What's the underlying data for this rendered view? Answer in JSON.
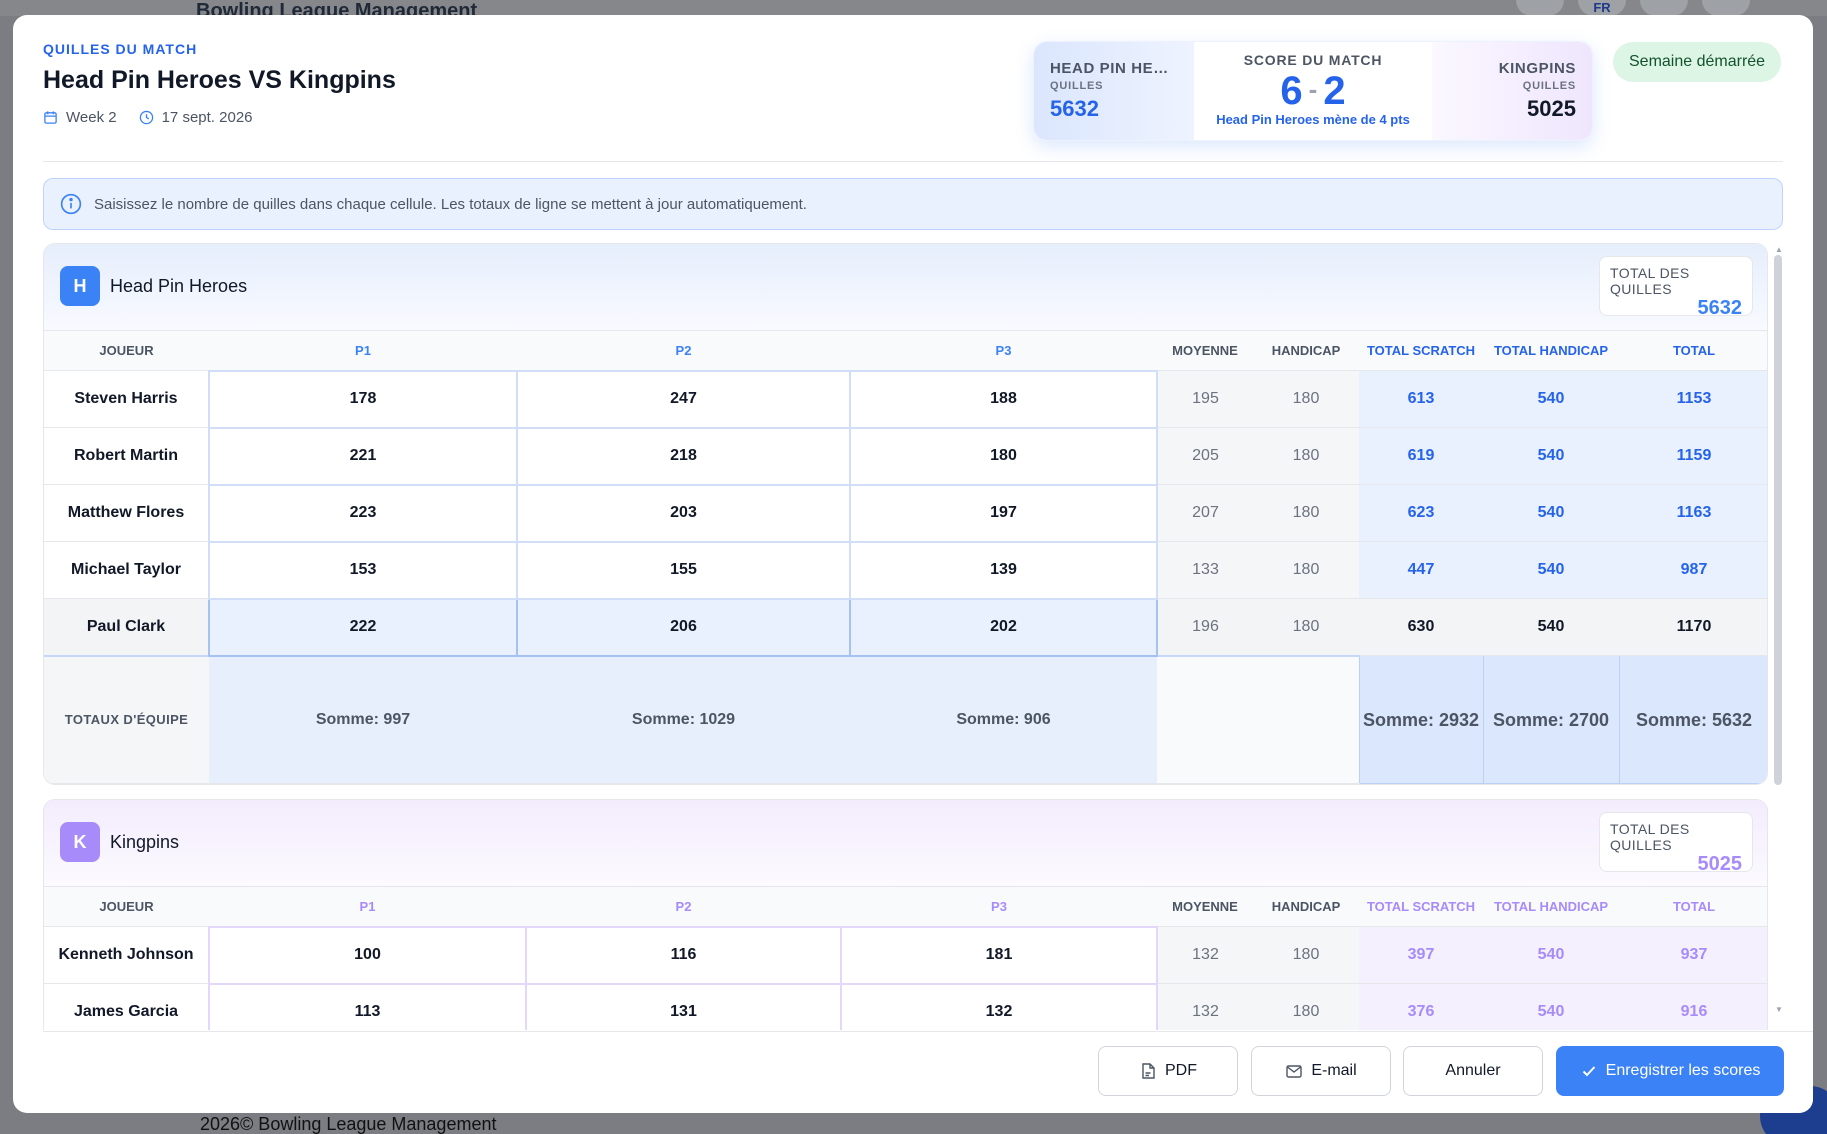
{
  "background": {
    "app_title": "Bowling League Management",
    "lang": "FR",
    "footer": "2026©  Bowling League Management"
  },
  "modal": {
    "eyebrow": "QUILLES DU MATCH",
    "title": "Head Pin Heroes VS Kingpins",
    "week": "Week 2",
    "date": "17 sept. 2026",
    "status": "Semaine démarrée",
    "info": "Saisissez le nombre de quilles dans chaque cellule. Les totaux de ligne se mettent à jour automatiquement."
  },
  "scorecard": {
    "left_name": "HEAD PIN HER...",
    "left_label": "QUILLES",
    "left_value": "5632",
    "mid_label": "SCORE DU MATCH",
    "home_points": "6",
    "away_points": "2",
    "lead_text": "Head Pin Heroes mène de 4 pts",
    "right_name": "KINGPINS",
    "right_label": "QUILLES",
    "right_value": "5025"
  },
  "columns": {
    "player": "JOUEUR",
    "p1": "P1",
    "p2": "P2",
    "p3": "P3",
    "avg": "MOYENNE",
    "hcp": "HANDICAP",
    "tscratch": "TOTAL SCRATCH",
    "thcp": "TOTAL HANDICAP",
    "total": "TOTAL"
  },
  "teamA": {
    "badge": "H",
    "name": "Head Pin Heroes",
    "total_label": "TOTAL DES QUILLES",
    "total_value": "5632",
    "rows": [
      {
        "player": "Steven Harris",
        "p1": "178",
        "p2": "247",
        "p3": "188",
        "avg": "195",
        "hcp": "180",
        "tscratch": "613",
        "thcp": "540",
        "total": "1153"
      },
      {
        "player": "Robert Martin",
        "p1": "221",
        "p2": "218",
        "p3": "180",
        "avg": "205",
        "hcp": "180",
        "tscratch": "619",
        "thcp": "540",
        "total": "1159"
      },
      {
        "player": "Matthew Flores",
        "p1": "223",
        "p2": "203",
        "p3": "197",
        "avg": "207",
        "hcp": "180",
        "tscratch": "623",
        "thcp": "540",
        "total": "1163"
      },
      {
        "player": "Michael Taylor",
        "p1": "153",
        "p2": "155",
        "p3": "139",
        "avg": "133",
        "hcp": "180",
        "tscratch": "447",
        "thcp": "540",
        "total": "987"
      },
      {
        "player": "Paul Clark",
        "p1": "222",
        "p2": "206",
        "p3": "202",
        "avg": "196",
        "hcp": "180",
        "tscratch": "630",
        "thcp": "540",
        "total": "1170"
      }
    ],
    "totals_label": "TOTAUX D'ÉQUIPE",
    "sum_p1": "Somme: 997",
    "sum_p2": "Somme: 1029",
    "sum_p3": "Somme: 906",
    "sum_scratch": "Somme: 2932",
    "sum_hcp": "Somme: 2700",
    "sum_total": "Somme: 5632"
  },
  "teamB": {
    "badge": "K",
    "name": "Kingpins",
    "total_label": "TOTAL DES QUILLES",
    "total_value": "5025",
    "rows": [
      {
        "player": "Kenneth Johnson",
        "p1": "100",
        "p2": "116",
        "p3": "181",
        "avg": "132",
        "hcp": "180",
        "tscratch": "397",
        "thcp": "540",
        "total": "937"
      },
      {
        "player": "James Garcia",
        "p1": "113",
        "p2": "131",
        "p3": "132",
        "avg": "132",
        "hcp": "180",
        "tscratch": "376",
        "thcp": "540",
        "total": "916"
      }
    ]
  },
  "buttons": {
    "pdf": "PDF",
    "email": "E-mail",
    "cancel": "Annuler",
    "save": "Enregistrer les scores"
  },
  "colors": {
    "primary": "#3b82f6",
    "teamB": "#a78bfa",
    "status_bg": "#dcf5e5"
  }
}
